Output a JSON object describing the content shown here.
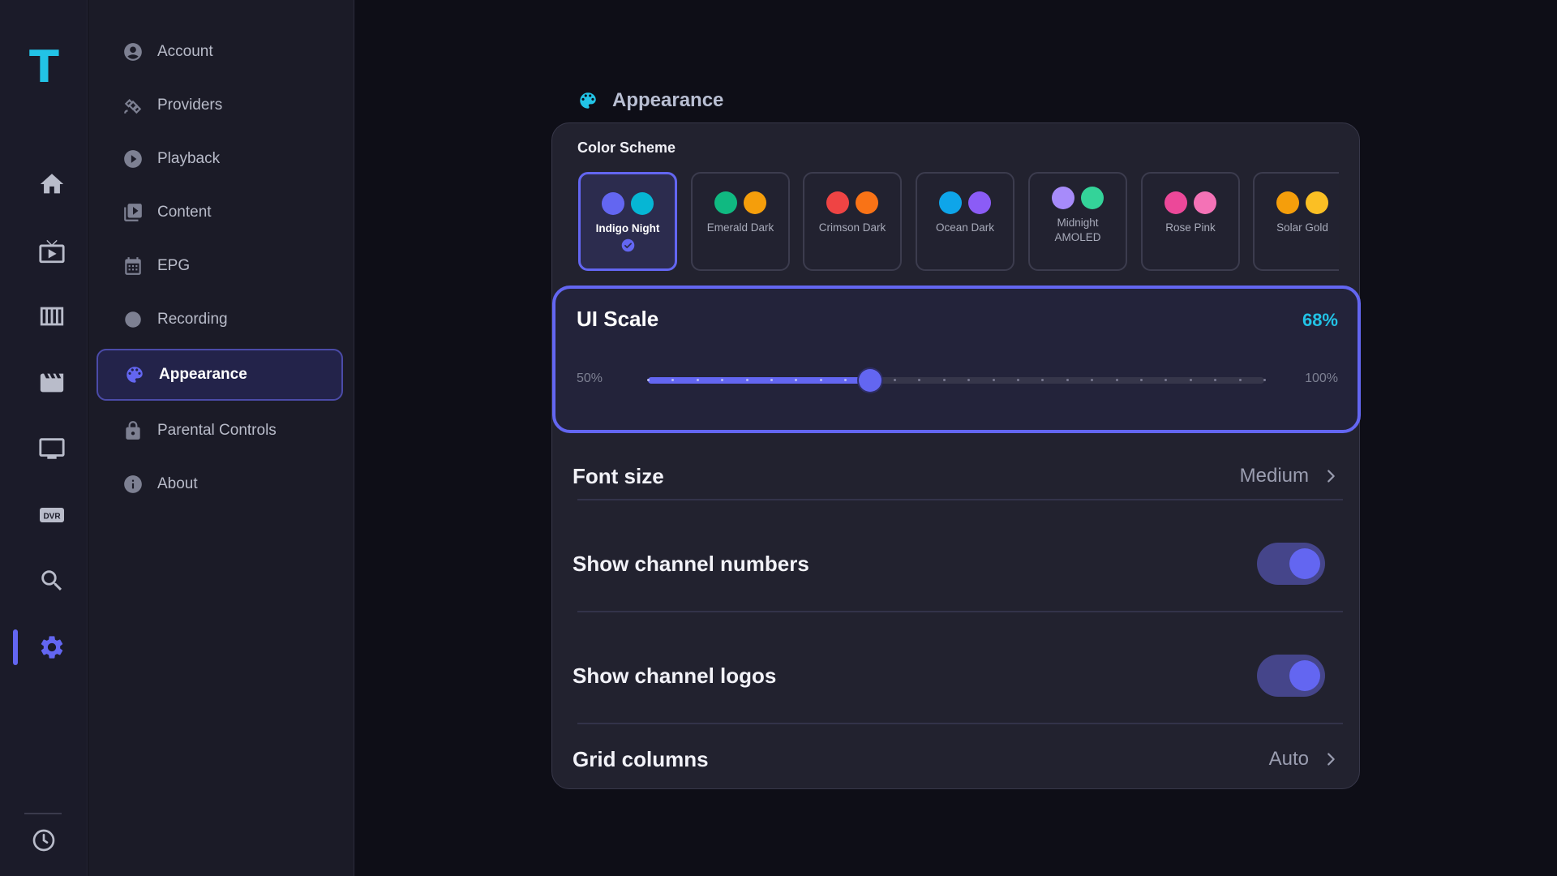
{
  "app": {
    "logo_letter": "T"
  },
  "rail": {
    "items": [
      {
        "icon": "home-icon"
      },
      {
        "icon": "live-tv-icon"
      },
      {
        "icon": "guide-grid-icon"
      },
      {
        "icon": "movies-icon"
      },
      {
        "icon": "monitor-icon"
      },
      {
        "icon": "dvr-icon",
        "text": "DVR"
      },
      {
        "icon": "search-icon"
      },
      {
        "icon": "settings-icon",
        "active": true
      }
    ],
    "bottom_icon": "clock-icon",
    "accent": "#6366f1"
  },
  "menu": {
    "items": [
      {
        "label": "Account",
        "icon": "account-icon"
      },
      {
        "label": "Providers",
        "icon": "satellite-icon"
      },
      {
        "label": "Playback",
        "icon": "play-circle-icon"
      },
      {
        "label": "Content",
        "icon": "video-library-icon"
      },
      {
        "label": "EPG",
        "icon": "calendar-icon"
      },
      {
        "label": "Recording",
        "icon": "record-dot-icon"
      },
      {
        "label": "Appearance",
        "icon": "palette-icon",
        "active": true
      },
      {
        "label": "Parental Controls",
        "icon": "lock-icon"
      },
      {
        "label": "About",
        "icon": "info-icon"
      }
    ]
  },
  "section": {
    "title": "Appearance",
    "icon": "palette-icon",
    "icon_color": "#22c3e6"
  },
  "color_scheme": {
    "label": "Color Scheme",
    "options": [
      {
        "name": "Indigo Night",
        "colors": [
          "#6366f1",
          "#06b6d4"
        ],
        "selected": true
      },
      {
        "name": "Emerald Dark",
        "colors": [
          "#10b981",
          "#f59e0b"
        ]
      },
      {
        "name": "Crimson Dark",
        "colors": [
          "#ef4444",
          "#f97316"
        ]
      },
      {
        "name": "Ocean Dark",
        "colors": [
          "#0ea5e9",
          "#8b5cf6"
        ]
      },
      {
        "name": "Midnight AMOLED",
        "colors": [
          "#a78bfa",
          "#34d399"
        ]
      },
      {
        "name": "Rose Pink",
        "colors": [
          "#ec4899",
          "#f472b6"
        ]
      },
      {
        "name": "Solar Gold",
        "colors": [
          "#f59e0b",
          "#fbbf24"
        ]
      }
    ]
  },
  "ui_scale": {
    "label": "UI Scale",
    "value_text": "68%",
    "min_label": "50%",
    "max_label": "100%",
    "value": 68,
    "min": 50,
    "max": 100
  },
  "rows": {
    "font_size": {
      "label": "Font size",
      "value": "Medium"
    },
    "show_channel_numbers": {
      "label": "Show channel numbers",
      "on": true
    },
    "show_channel_logos": {
      "label": "Show channel logos",
      "on": true
    },
    "grid_columns": {
      "label": "Grid columns",
      "value": "Auto"
    }
  }
}
